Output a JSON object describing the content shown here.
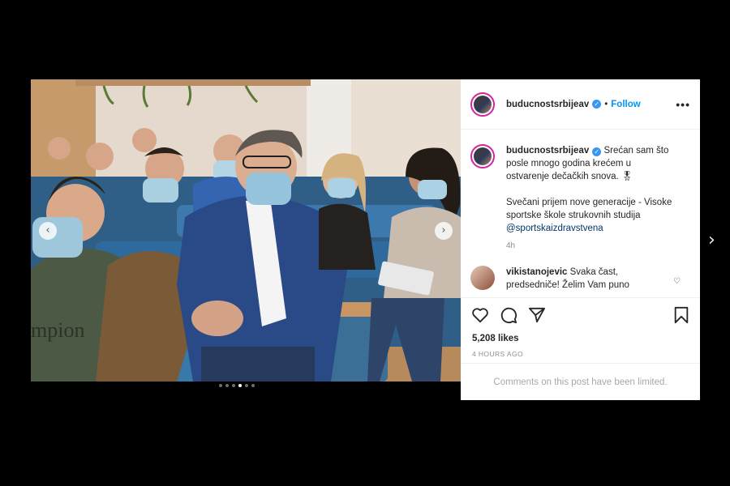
{
  "post": {
    "username": "buducnostsrbijeav",
    "follow_label": "Follow",
    "separator": "•",
    "more_label": "•••",
    "verified_glyph": "✓",
    "caption_line1": "Srećan sam što posle mnogo godina krećem u ostvarenje dečačkih snova. 🎖",
    "caption_line2": "Svečani prijem nove generacije - Visoke sportske škole strukovnih studija",
    "caption_mention": "@sportskaizdravstvena",
    "caption_time": "4h",
    "likes": "5,208 likes",
    "time_ago": "4 HOURS AGO",
    "comments_limited": "Comments on this post have been limited."
  },
  "comments": [
    {
      "username": "vikistanojevic",
      "text": "Svaka čast, predsedniče! Želim Vam puno"
    }
  ],
  "carousel": {
    "prev_glyph": "‹",
    "next_glyph": "›",
    "outer_next_glyph": "›",
    "dot_count": 6,
    "active_index": 3
  },
  "icons": [
    "heart-icon",
    "comment-icon",
    "share-icon",
    "bookmark-icon",
    "verified-icon",
    "more-icon"
  ],
  "colors": {
    "accent": "#0095f6",
    "verified": "#3897f0",
    "story_ring": "#d6249f"
  },
  "photo": {
    "shirt_text": "mpion"
  }
}
